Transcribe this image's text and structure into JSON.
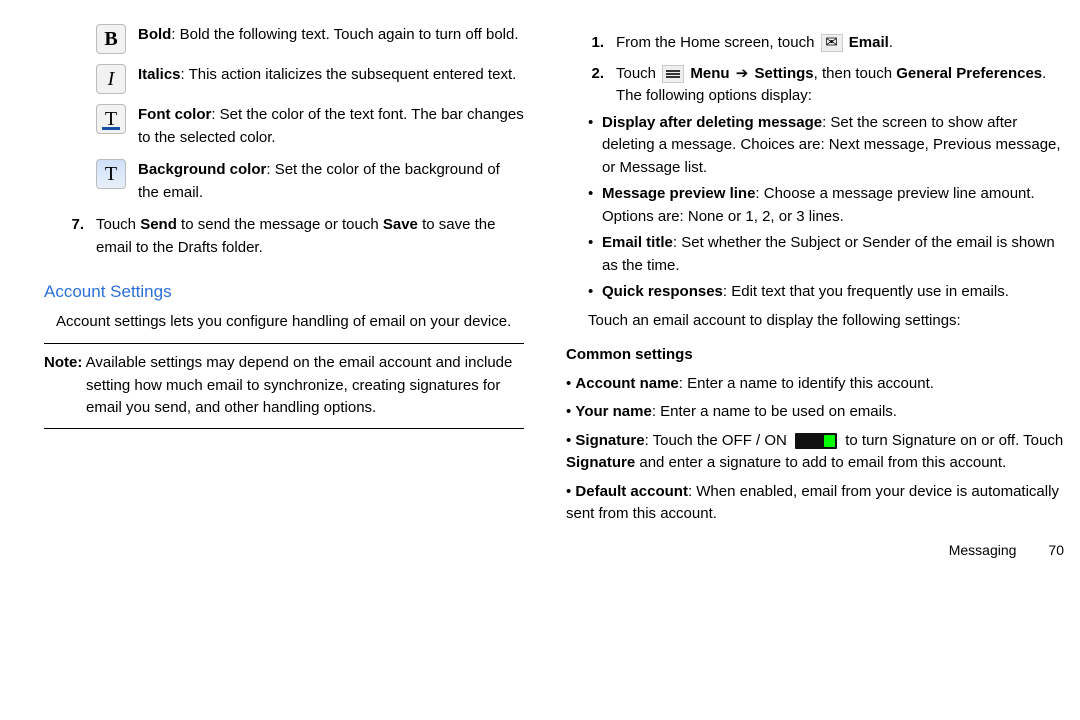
{
  "left": {
    "bold": {
      "label": "Bold",
      "text": ": Bold the following text. Touch again to turn off bold.",
      "glyph": "B"
    },
    "italics": {
      "label": "Italics",
      "text": ": This action italicizes the subsequent entered text.",
      "glyph": "I"
    },
    "fontcolor": {
      "label": "Font color",
      "text": ": Set the color of the text font. The bar changes to the selected color.",
      "glyph": "T"
    },
    "bgcolor": {
      "label": "Background color",
      "text": ": Set the color of the background of the email.",
      "glyph": "T"
    },
    "step7_num": "7.",
    "step7_a": "Touch ",
    "step7_send": "Send",
    "step7_b": " to send the message or touch ",
    "step7_save": "Save",
    "step7_c": " to save the email to the Drafts folder.",
    "acct_title": "Account Settings",
    "acct_desc": "Account settings lets you configure handling of email on your device.",
    "note_label": "Note:",
    "note_text": " Available settings may depend on the email account and include setting how much email to synchronize, creating signatures for email you send, and other handling options."
  },
  "right": {
    "s1_num": "1.",
    "s1_a": "From the Home screen, touch ",
    "s1_email": "Email",
    "s1_dot": ".",
    "s2_num": "2.",
    "s2_a": "Touch ",
    "s2_menu": "Menu",
    "s2_arrow": "➔",
    "s2_settings": "Settings",
    "s2_b": ", then touch ",
    "s2_general": "General Preferences",
    "s2_c": ". The following options display:",
    "b1_label": "Display after deleting message",
    "b1_text": ": Set the screen to show after deleting a message. Choices are: Next message, Previous message, or Message list.",
    "b2_label": "Message preview line",
    "b2_text": ": Choose a message preview line amount. Options are: None or 1, 2, or 3 lines.",
    "b3_label": "Email title",
    "b3_text": ": Set whether the Subject or Sender of the email is shown as the time.",
    "b4_label": "Quick responses",
    "b4_text": ": Edit text that you frequently use in emails.",
    "touch_acct": "Touch an email account to display the following settings:",
    "common": "Common settings",
    "c1_label": "Account name",
    "c1_text": ": Enter a name to identify this account.",
    "c2_label": "Your name",
    "c2_text": ": Enter a name to be used on emails.",
    "c3_label": "Signature",
    "c3_a": ": Touch the OFF / ON",
    "c3_b": " to turn Signature on or off. Touch ",
    "c3_sig": "Signature",
    "c3_c": " and enter a signature to add to email from this account.",
    "c4_label": "Default account",
    "c4_text": ": When enabled, email from your device is automatically sent from this account."
  },
  "footer": {
    "section": "Messaging",
    "page": "70"
  }
}
